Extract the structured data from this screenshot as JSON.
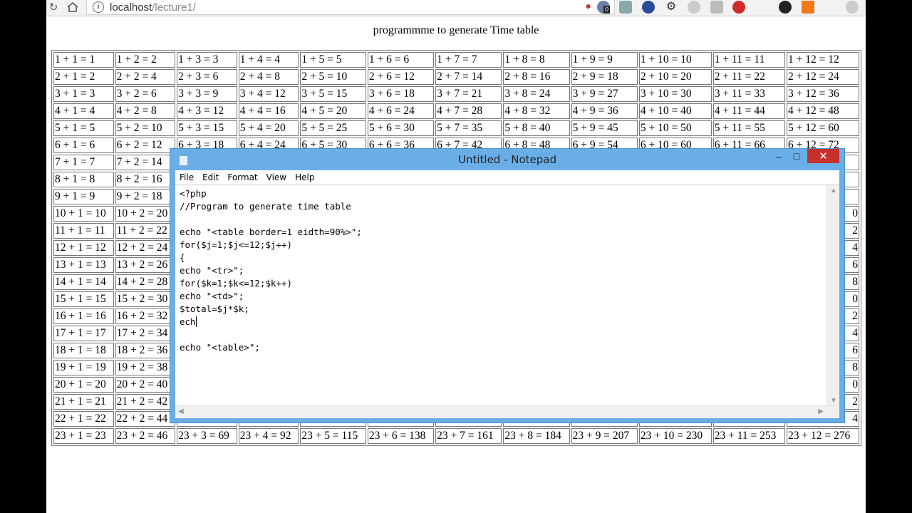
{
  "browser": {
    "url_host": "localhost",
    "url_path": "/lecture1/",
    "ext_badge": "0"
  },
  "page": {
    "title": "programmme to generate Time table",
    "rows": [
      [
        "1 + 1 = 1",
        "1 + 2 = 2",
        "1 + 3 = 3",
        "1 + 4 = 4",
        "1 + 5 = 5",
        "1 + 6 = 6",
        "1 + 7 = 7",
        "1 + 8 = 8",
        "1 + 9 = 9",
        "1 + 10 = 10",
        "1 + 11 = 11",
        "1 + 12 = 12"
      ],
      [
        "2 + 1 = 2",
        "2 + 2 = 4",
        "2 + 3 = 6",
        "2 + 4 = 8",
        "2 + 5 = 10",
        "2 + 6 = 12",
        "2 + 7 = 14",
        "2 + 8 = 16",
        "2 + 9 = 18",
        "2 + 10 = 20",
        "2 + 11 = 22",
        "2 + 12 = 24"
      ],
      [
        "3 + 1 = 3",
        "3 + 2 = 6",
        "3 + 3 = 9",
        "3 + 4 = 12",
        "3 + 5 = 15",
        "3 + 6 = 18",
        "3 + 7 = 21",
        "3 + 8 = 24",
        "3 + 9 = 27",
        "3 + 10 = 30",
        "3 + 11 = 33",
        "3 + 12 = 36"
      ],
      [
        "4 + 1 = 4",
        "4 + 2 = 8",
        "4 + 3 = 12",
        "4 + 4 = 16",
        "4 + 5 = 20",
        "4 + 6 = 24",
        "4 + 7 = 28",
        "4 + 8 = 32",
        "4 + 9 = 36",
        "4 + 10 = 40",
        "4 + 11 = 44",
        "4 + 12 = 48"
      ],
      [
        "5 + 1 = 5",
        "5 + 2 = 10",
        "5 + 3 = 15",
        "5 + 4 = 20",
        "5 + 5 = 25",
        "5 + 6 = 30",
        "5 + 7 = 35",
        "5 + 8 = 40",
        "5 + 9 = 45",
        "5 + 10 = 50",
        "5 + 11 = 55",
        "5 + 12 = 60"
      ],
      [
        "6 + 1 = 6",
        "6 + 2 = 12",
        "6 + 3 = 18",
        "6 + 4 = 24",
        "6 + 5 = 30",
        "6 + 6 = 36",
        "6 + 7 = 42",
        "6 + 8 = 48",
        "6 + 9 = 54",
        "6 + 10 = 60",
        "6 + 11 = 66",
        "6 + 12 = 72"
      ],
      [
        "7 + 1 = 7",
        "7 + 2 = 14",
        "",
        "",
        "",
        "",
        "",
        "",
        "",
        "",
        "",
        ""
      ],
      [
        "8 + 1 = 8",
        "8 + 2 = 16",
        "",
        "",
        "",
        "",
        "",
        "",
        "",
        "",
        "",
        ""
      ],
      [
        "9 + 1 = 9",
        "9 + 2 = 18",
        "",
        "",
        "",
        "",
        "",
        "",
        "",
        "",
        "",
        ""
      ],
      [
        "10 + 1 = 10",
        "10 + 2 = 20",
        "",
        "",
        "",
        "",
        "",
        "",
        "",
        "",
        "",
        "0"
      ],
      [
        "11 + 1 = 11",
        "11 + 2 = 22",
        "",
        "",
        "",
        "",
        "",
        "",
        "",
        "",
        "",
        "2"
      ],
      [
        "12 + 1 = 12",
        "12 + 2 = 24",
        "",
        "",
        "",
        "",
        "",
        "",
        "",
        "",
        "",
        "4"
      ],
      [
        "13 + 1 = 13",
        "13 + 2 = 26",
        "",
        "",
        "",
        "",
        "",
        "",
        "",
        "",
        "",
        "6"
      ],
      [
        "14 + 1 = 14",
        "14 + 2 = 28",
        "",
        "",
        "",
        "",
        "",
        "",
        "",
        "",
        "",
        "8"
      ],
      [
        "15 + 1 = 15",
        "15 + 2 = 30",
        "",
        "",
        "",
        "",
        "",
        "",
        "",
        "",
        "",
        "0"
      ],
      [
        "16 + 1 = 16",
        "16 + 2 = 32",
        "",
        "",
        "",
        "",
        "",
        "",
        "",
        "",
        "",
        "2"
      ],
      [
        "17 + 1 = 17",
        "17 + 2 = 34",
        "",
        "",
        "",
        "",
        "",
        "",
        "",
        "",
        "",
        "4"
      ],
      [
        "18 + 1 = 18",
        "18 + 2 = 36",
        "",
        "",
        "",
        "",
        "",
        "",
        "",
        "",
        "",
        "6"
      ],
      [
        "19 + 1 = 19",
        "19 + 2 = 38",
        "",
        "",
        "",
        "",
        "",
        "",
        "",
        "",
        "",
        "8"
      ],
      [
        "20 + 1 = 20",
        "20 + 2 = 40",
        "",
        "",
        "",
        "",
        "",
        "",
        "",
        "",
        "",
        "0"
      ],
      [
        "21 + 1 = 21",
        "21 + 2 = 42",
        "",
        "",
        "",
        "",
        "",
        "",
        "",
        "",
        "",
        "2"
      ],
      [
        "22 + 1 = 22",
        "22 + 2 = 44",
        "",
        "",
        "",
        "",
        "",
        "",
        "",
        "",
        "",
        "4"
      ],
      [
        "23 + 1 = 23",
        "23 + 2 = 46",
        "23 + 3 = 69",
        "23 + 4 = 92",
        "23 + 5 = 115",
        "23 + 6 = 138",
        "23 + 7 = 161",
        "23 + 8 = 184",
        "23 + 9 = 207",
        "23 + 10 = 230",
        "23 + 11 = 253",
        "23 + 12 = 276"
      ]
    ]
  },
  "notepad": {
    "title": "Untitled - Notepad",
    "menu": [
      "File",
      "Edit",
      "Format",
      "View",
      "Help"
    ],
    "code_lines": [
      "<?php",
      "//Program to generate time table",
      "",
      "echo \"<table border=1 eidth=90%>\";",
      "for($j=1;$j<=12;$j++)",
      "{",
      "echo \"<tr>\";",
      "for($k=1;$k<=12;$k++)",
      "echo \"<td>\";",
      "$total=$j*$k;",
      "ech",
      "",
      "echo \"<table>\";"
    ],
    "caret_line": 10
  }
}
